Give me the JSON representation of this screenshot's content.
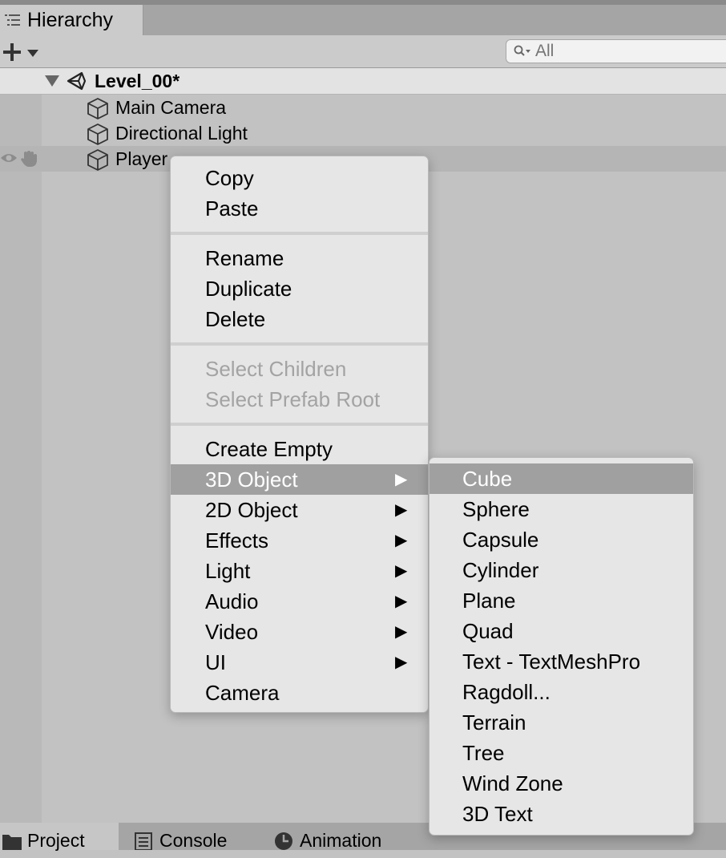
{
  "window": {
    "tab_title": "Hierarchy",
    "accent_highlight": "#a0a0a0"
  },
  "toolbar": {
    "add_icon": "plus-icon",
    "dropdown_icon": "caret-down-icon",
    "search_placeholder": "All",
    "search_icon": "search-icon"
  },
  "hierarchy": {
    "scene": {
      "name": "Level_00*",
      "icon": "unity-logo-icon",
      "expanded": true
    },
    "objects": [
      {
        "name": "Main Camera",
        "icon": "cube-icon"
      },
      {
        "name": "Directional Light",
        "icon": "cube-icon"
      },
      {
        "name": "Player",
        "icon": "cube-icon",
        "hovered": true
      }
    ]
  },
  "context_menu": {
    "groups": [
      [
        "Copy",
        "Paste"
      ],
      [
        "Rename",
        "Duplicate",
        "Delete"
      ],
      [
        "Select Children",
        "Select Prefab Root"
      ],
      [
        "Create Empty",
        "3D Object",
        "2D Object",
        "Effects",
        "Light",
        "Audio",
        "Video",
        "UI",
        "Camera"
      ]
    ],
    "disabled": [
      "Select Children",
      "Select Prefab Root"
    ],
    "submenu_items": [
      "3D Object",
      "2D Object",
      "Effects",
      "Light",
      "Audio",
      "Video",
      "UI"
    ],
    "highlighted": "3D Object",
    "arrow_glyph": "▶"
  },
  "submenu_3d_object": {
    "items": [
      "Cube",
      "Sphere",
      "Capsule",
      "Cylinder",
      "Plane",
      "Quad",
      "Text - TextMeshPro",
      "Ragdoll...",
      "Terrain",
      "Tree",
      "Wind Zone",
      "3D Text"
    ],
    "highlighted": "Cube"
  },
  "bottom_tabs": [
    {
      "label": "Project",
      "icon": "folder-icon",
      "active": true
    },
    {
      "label": "Console",
      "icon": "console-icon",
      "active": false
    },
    {
      "label": "Animation",
      "icon": "clock-icon",
      "active": false
    }
  ]
}
